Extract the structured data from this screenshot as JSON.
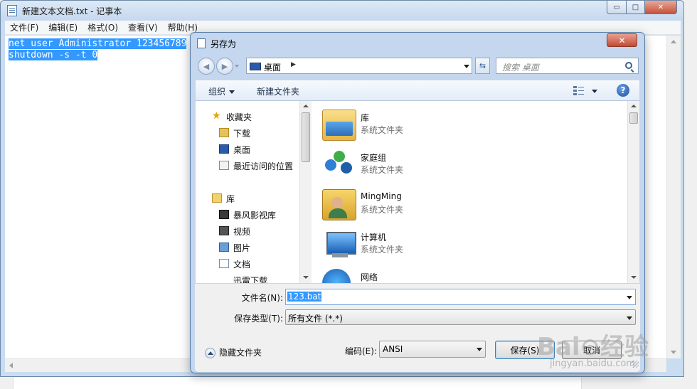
{
  "notepad": {
    "title": "新建文本文档.txt - 记事本",
    "window_buttons": {
      "minimize": "▭",
      "maximize": "□",
      "close": "✕"
    },
    "menu": [
      "文件(F)",
      "编辑(E)",
      "格式(O)",
      "查看(V)",
      "帮助(H)"
    ],
    "lines": [
      "net user Administrator 123456789",
      "shutdown -s -t 0"
    ]
  },
  "dialog": {
    "title": "另存为",
    "close": "✕",
    "address": {
      "location": "桌面",
      "separator": "▶"
    },
    "search_placeholder": "搜索 桌面",
    "toolbar": {
      "organize": "组织",
      "new_folder": "新建文件夹",
      "help": "?"
    },
    "nav_pane": {
      "favorites": {
        "label": "收藏夹",
        "items": [
          "下载",
          "桌面",
          "最近访问的位置"
        ]
      },
      "libraries": {
        "label": "库",
        "items": [
          "暴风影视库",
          "视频",
          "图片",
          "文档",
          "迅雷下载"
        ]
      }
    },
    "files": [
      {
        "name": "库",
        "type": "系统文件夹",
        "icon": "library-icon"
      },
      {
        "name": "家庭组",
        "type": "系统文件夹",
        "icon": "homegroup-icon"
      },
      {
        "name": "MingMing",
        "type": "系统文件夹",
        "icon": "user-folder-icon"
      },
      {
        "name": "计算机",
        "type": "系统文件夹",
        "icon": "computer-icon"
      },
      {
        "name": "网络",
        "type": "",
        "icon": "network-icon"
      }
    ],
    "form": {
      "filename_label": "文件名(N):",
      "filename_value": "123.bat",
      "filetype_label": "保存类型(T):",
      "filetype_value": "所有文件  (*.*)",
      "hide_folders": "隐藏文件夹",
      "encoding_label": "编码(E):",
      "encoding_value": "ANSI",
      "save": "保存(S)",
      "cancel": "取消"
    }
  },
  "watermark": {
    "main": "Bai⊙经验",
    "sub": "jingyan.baidu.com"
  },
  "colors": {
    "selection": "#3399ff",
    "window_frame": "#c4d7ee"
  }
}
